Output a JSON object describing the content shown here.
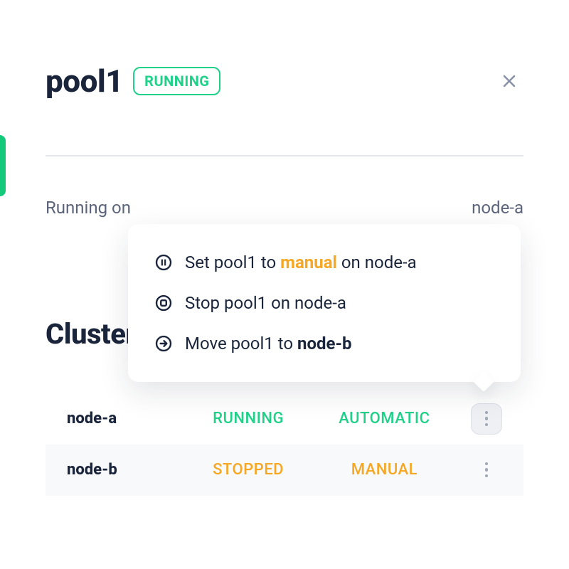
{
  "header": {
    "title": "pool1",
    "status": "RUNNING"
  },
  "running": {
    "label": "Running on",
    "node": "node-a"
  },
  "section": {
    "title": "Cluster"
  },
  "rows": [
    {
      "node": "node-a",
      "status": "RUNNING",
      "status_color": "green",
      "mode": "AUTOMATIC",
      "mode_color": "green",
      "active": true
    },
    {
      "node": "node-b",
      "status": "STOPPED",
      "status_color": "orange",
      "mode": "MANUAL",
      "mode_color": "orange",
      "active": false
    }
  ],
  "menu": {
    "items": [
      {
        "icon": "pause",
        "prefix": "Set pool1 to ",
        "highlight": "manual",
        "highlight_color": "orange",
        "suffix": " on node-a"
      },
      {
        "icon": "stop",
        "prefix": "Stop pool1 on node-a",
        "highlight": "",
        "highlight_color": "",
        "suffix": ""
      },
      {
        "icon": "move",
        "prefix": "Move pool1 to ",
        "highlight": "node-b",
        "highlight_color": "dark",
        "suffix": ""
      }
    ]
  }
}
